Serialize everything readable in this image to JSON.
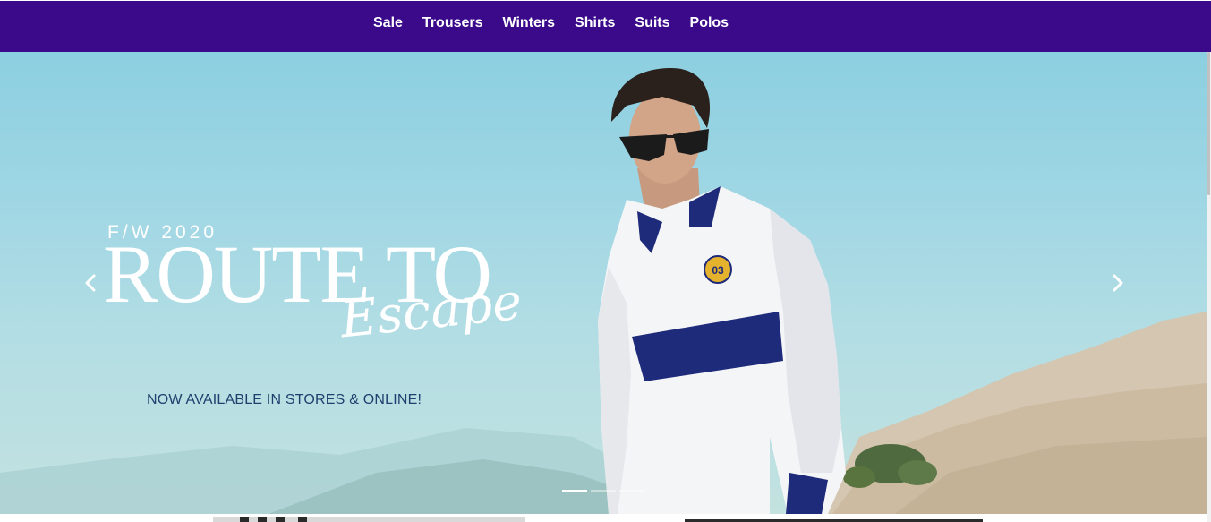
{
  "nav": {
    "items": [
      {
        "label": "Sale"
      },
      {
        "label": "Trousers"
      },
      {
        "label": "Winters"
      },
      {
        "label": "Shirts"
      },
      {
        "label": "Suits"
      },
      {
        "label": "Polos"
      }
    ],
    "background": "#3a0a8a"
  },
  "hero": {
    "season": "F/W 2020",
    "headline": "ROUTE TO",
    "script": "Escape",
    "subline": "NOW AVAILABLE IN STORES & ONLINE!",
    "prev_icon": "chevron-left-icon",
    "next_icon": "chevron-right-icon",
    "slide_count": 3,
    "active_slide": 1,
    "polo_badge": "03"
  },
  "colors": {
    "sky": "#8ccfe0",
    "navy": "#1e2a7a",
    "subline": "#1f3f6e"
  }
}
